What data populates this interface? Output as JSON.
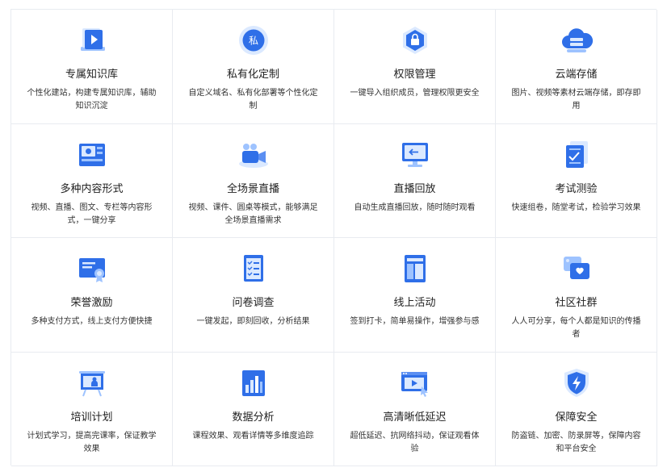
{
  "features": [
    {
      "icon": "video-library-icon",
      "title": "专属知识库",
      "desc": "个性化建站，构建专属知识库，辅助知识沉淀"
    },
    {
      "icon": "private-badge-icon",
      "title": "私有化定制",
      "desc": "自定义域名、私有化部署等个性化定制",
      "badge": "私"
    },
    {
      "icon": "lock-shield-icon",
      "title": "权限管理",
      "desc": "一键导入组织成员，管理权限更安全"
    },
    {
      "icon": "cloud-storage-icon",
      "title": "云端存储",
      "desc": "图片、视频等素材云端存储，即存即用"
    },
    {
      "icon": "multi-content-icon",
      "title": "多种内容形式",
      "desc": "视频、直播、图文、专栏等内容形式，一键分享"
    },
    {
      "icon": "camera-live-icon",
      "title": "全场景直播",
      "desc": "视频、课件、圆桌等模式，能够满足全场景直播需求"
    },
    {
      "icon": "monitor-replay-icon",
      "title": "直播回放",
      "desc": "自动生成直播回放，随时随时观看"
    },
    {
      "icon": "exam-paper-icon",
      "title": "考试测验",
      "desc": "快速组卷，随堂考试，检验学习效果"
    },
    {
      "icon": "certificate-icon",
      "title": "荣誉激励",
      "desc": "多种支付方式，线上支付方便快捷"
    },
    {
      "icon": "checklist-survey-icon",
      "title": "问卷调查",
      "desc": "一键发起，即刻回收，分析结果"
    },
    {
      "icon": "online-activity-icon",
      "title": "线上活动",
      "desc": "签到打卡，简单易操作，增强参与感"
    },
    {
      "icon": "community-chat-icon",
      "title": "社区社群",
      "desc": "人人可分享，每个人都是知识的传播者"
    },
    {
      "icon": "training-board-icon",
      "title": "培训计划",
      "desc": "计划式学习，提高完课率，保证教学效果"
    },
    {
      "icon": "bar-chart-icon",
      "title": "数据分析",
      "desc": "课程效果、观看详情等多维度追踪"
    },
    {
      "icon": "hd-player-icon",
      "title": "高清晰低延迟",
      "desc": "超低延迟、抗网络抖动，保证观看体验"
    },
    {
      "icon": "security-shield-icon",
      "title": "保障安全",
      "desc": "防盗链、加密、防录屏等，保障内容和平台安全"
    }
  ],
  "colors": {
    "primary": "#2f6fe8",
    "light": "#9ec3ff",
    "pale": "#dbe9ff"
  }
}
